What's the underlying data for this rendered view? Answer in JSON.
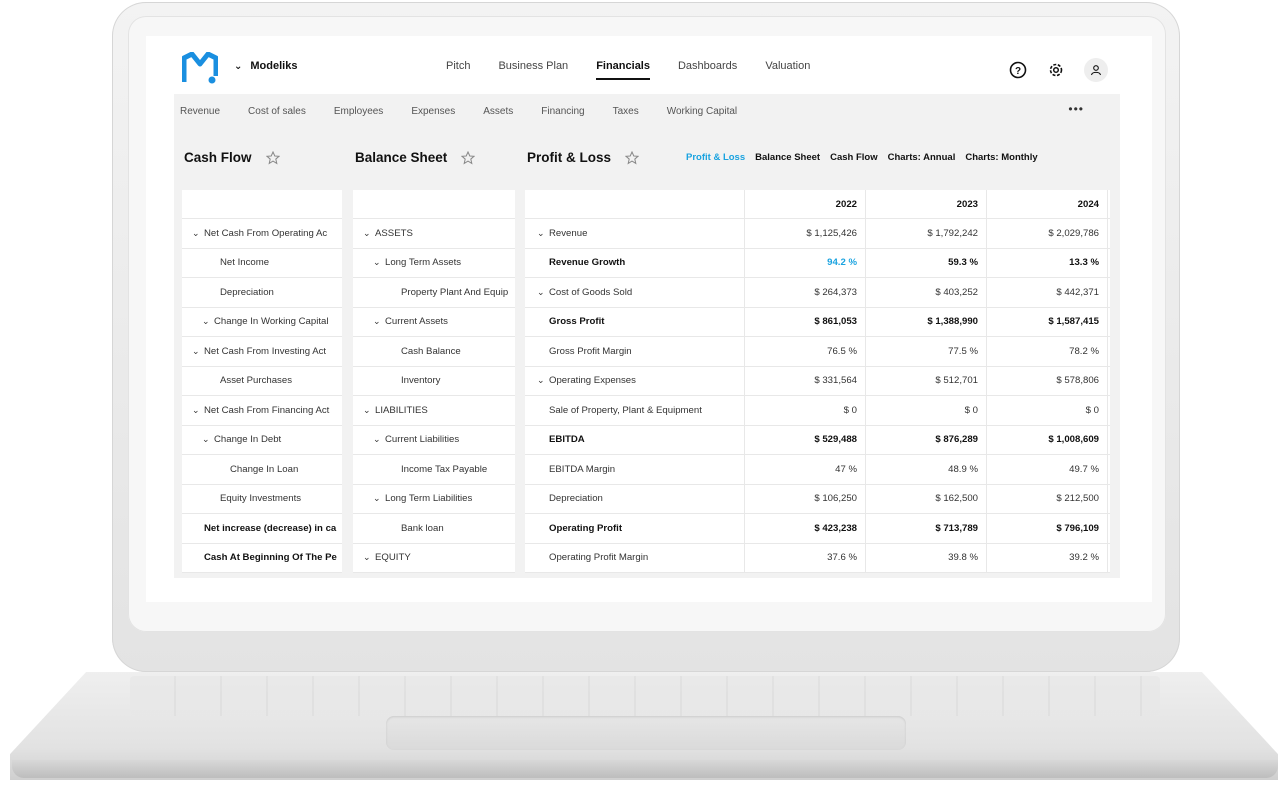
{
  "app": {
    "brand": "Modeliks"
  },
  "topnav": [
    "Pitch",
    "Business Plan",
    "Financials",
    "Dashboards",
    "Valuation"
  ],
  "topnav_active": "Financials",
  "subnav": [
    "Revenue",
    "Cost of sales",
    "Employees",
    "Expenses",
    "Assets",
    "Financing",
    "Taxes",
    "Working Capital"
  ],
  "sections": {
    "cash_flow": "Cash Flow",
    "balance_sheet": "Balance Sheet",
    "profit_loss": "Profit & Loss"
  },
  "pl_links": [
    "Profit & Loss",
    "Balance Sheet",
    "Cash Flow",
    "Charts: Annual",
    "Charts: Monthly"
  ],
  "cash_flow_rows": [
    {
      "label": "Net Cash From Operating Ac",
      "indent": 0,
      "chev": true,
      "bold": false
    },
    {
      "label": "Net Income",
      "indent": 2,
      "chev": false,
      "bold": false
    },
    {
      "label": "Depreciation",
      "indent": 2,
      "chev": false,
      "bold": false
    },
    {
      "label": "Change In Working Capital",
      "indent": 1,
      "chev": true,
      "bold": false
    },
    {
      "label": "Net Cash From Investing Act",
      "indent": 0,
      "chev": true,
      "bold": false
    },
    {
      "label": "Asset Purchases",
      "indent": 2,
      "chev": false,
      "bold": false
    },
    {
      "label": "Net Cash From Financing Act",
      "indent": 0,
      "chev": true,
      "bold": false
    },
    {
      "label": "Change In Debt",
      "indent": 1,
      "chev": true,
      "bold": false
    },
    {
      "label": "Change In Loan",
      "indent": 3,
      "chev": false,
      "bold": false
    },
    {
      "label": "Equity Investments",
      "indent": 2,
      "chev": false,
      "bold": false
    },
    {
      "label": "Net increase (decrease) in ca",
      "indent": 0,
      "chev": false,
      "bold": true
    },
    {
      "label": "Cash At Beginning Of The Pe",
      "indent": 0,
      "chev": false,
      "bold": true
    }
  ],
  "balance_rows": [
    {
      "label": "ASSETS",
      "indent": 0,
      "chev": true
    },
    {
      "label": "Long Term Assets",
      "indent": 1,
      "chev": true
    },
    {
      "label": "Property Plant And Equip",
      "indent": 3,
      "chev": false
    },
    {
      "label": "Current Assets",
      "indent": 1,
      "chev": true
    },
    {
      "label": "Cash Balance",
      "indent": 3,
      "chev": false
    },
    {
      "label": "Inventory",
      "indent": 3,
      "chev": false
    },
    {
      "label": "LIABILITIES",
      "indent": 0,
      "chev": true
    },
    {
      "label": "Current Liabilities",
      "indent": 1,
      "chev": true
    },
    {
      "label": "Income Tax Payable",
      "indent": 3,
      "chev": false
    },
    {
      "label": "Long Term Liabilities",
      "indent": 1,
      "chev": true
    },
    {
      "label": "Bank loan",
      "indent": 3,
      "chev": false
    },
    {
      "label": "EQUITY",
      "indent": 0,
      "chev": true
    }
  ],
  "pl_years": [
    "2022",
    "2023",
    "2024"
  ],
  "pl_rows": [
    {
      "label": "Revenue",
      "chev": true,
      "bold": false,
      "values": [
        "$ 1,125,426",
        "$ 1,792,242",
        "$ 2,029,786"
      ]
    },
    {
      "label": "Revenue Growth",
      "chev": false,
      "bold": true,
      "values": [
        "94.2 %",
        "59.3 %",
        "13.3 %"
      ],
      "highlight_first": true
    },
    {
      "label": "Cost of Goods Sold",
      "chev": true,
      "bold": false,
      "values": [
        "$ 264,373",
        "$ 403,252",
        "$ 442,371"
      ]
    },
    {
      "label": "Gross Profit",
      "chev": false,
      "bold": true,
      "values": [
        "$ 861,053",
        "$ 1,388,990",
        "$ 1,587,415"
      ]
    },
    {
      "label": "Gross Profit Margin",
      "chev": false,
      "bold": false,
      "values": [
        "76.5 %",
        "77.5 %",
        "78.2 %"
      ]
    },
    {
      "label": "Operating Expenses",
      "chev": true,
      "bold": false,
      "values": [
        "$ 331,564",
        "$ 512,701",
        "$ 578,806"
      ]
    },
    {
      "label": "Sale of Property, Plant & Equipment",
      "chev": false,
      "bold": false,
      "values": [
        "$ 0",
        "$ 0",
        "$ 0"
      ]
    },
    {
      "label": "EBITDA",
      "chev": false,
      "bold": true,
      "values": [
        "$ 529,488",
        "$ 876,289",
        "$ 1,008,609"
      ]
    },
    {
      "label": "EBITDA Margin",
      "chev": false,
      "bold": false,
      "values": [
        "47 %",
        "48.9 %",
        "49.7 %"
      ]
    },
    {
      "label": "Depreciation",
      "chev": false,
      "bold": false,
      "values": [
        "$ 106,250",
        "$ 162,500",
        "$ 212,500"
      ]
    },
    {
      "label": "Operating Profit",
      "chev": false,
      "bold": true,
      "values": [
        "$ 423,238",
        "$ 713,789",
        "$ 796,109"
      ]
    },
    {
      "label": "Operating Profit Margin",
      "chev": false,
      "bold": false,
      "values": [
        "37.6 %",
        "39.8 %",
        "39.2 %"
      ]
    }
  ],
  "colors": {
    "accent": "#1aa3e0",
    "logo": "#1a8fe0"
  }
}
